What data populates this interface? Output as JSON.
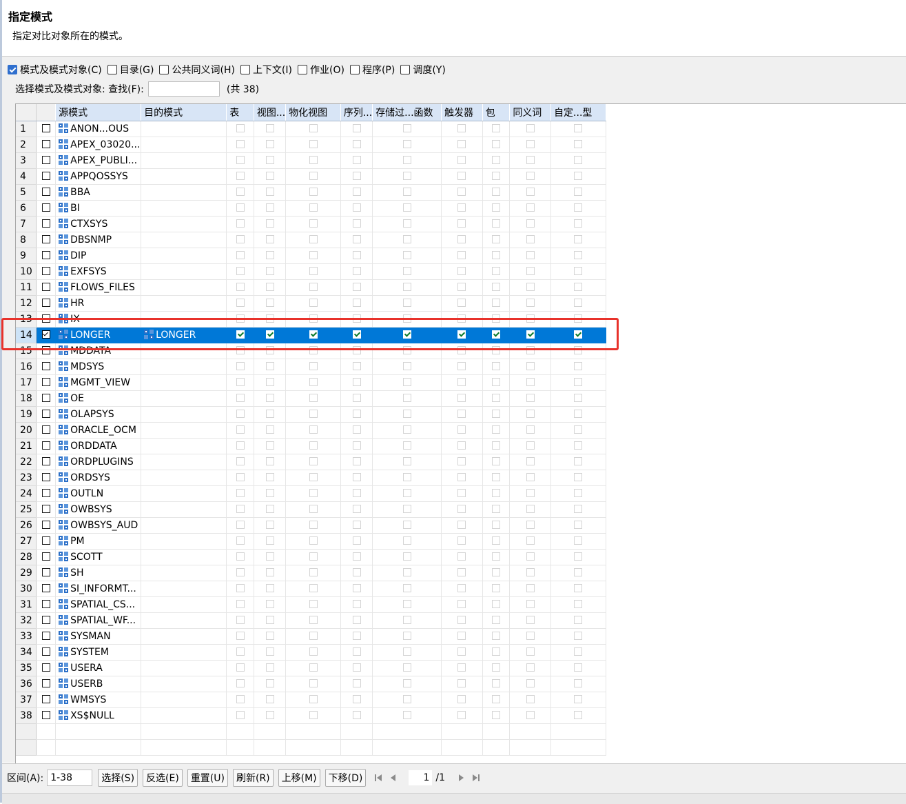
{
  "header": {
    "title": "指定模式",
    "description": "指定对比对象所在的模式。"
  },
  "options": [
    {
      "label": "模式及模式对象(C)",
      "checked": true
    },
    {
      "label": "目录(G)",
      "checked": false
    },
    {
      "label": "公共同义词(H)",
      "checked": false
    },
    {
      "label": "上下文(I)",
      "checked": false
    },
    {
      "label": "作业(O)",
      "checked": false
    },
    {
      "label": "程序(P)",
      "checked": false
    },
    {
      "label": "调度(Y)",
      "checked": false
    }
  ],
  "search": {
    "label": "选择模式及模式对象: 查找(F):",
    "value": "",
    "total": "(共 38)"
  },
  "columns": [
    "源模式",
    "目的模式",
    "表",
    "视图...",
    "物化视图",
    "序列...",
    "存储过...函数",
    "触发器",
    "包",
    "同义词",
    "自定...型"
  ],
  "rows": [
    {
      "no": "1",
      "source": "ANON...OUS",
      "target": "",
      "checked": false
    },
    {
      "no": "2",
      "source": "APEX_03020...",
      "target": "",
      "checked": false
    },
    {
      "no": "3",
      "source": "APEX_PUBLI...",
      "target": "",
      "checked": false
    },
    {
      "no": "4",
      "source": "APPQOSSYS",
      "target": "",
      "checked": false
    },
    {
      "no": "5",
      "source": "BBA",
      "target": "",
      "checked": false
    },
    {
      "no": "6",
      "source": "BI",
      "target": "",
      "checked": false
    },
    {
      "no": "7",
      "source": "CTXSYS",
      "target": "",
      "checked": false
    },
    {
      "no": "8",
      "source": "DBSNMP",
      "target": "",
      "checked": false
    },
    {
      "no": "9",
      "source": "DIP",
      "target": "",
      "checked": false
    },
    {
      "no": "10",
      "source": "EXFSYS",
      "target": "",
      "checked": false
    },
    {
      "no": "11",
      "source": "FLOWS_FILES",
      "target": "",
      "checked": false
    },
    {
      "no": "12",
      "source": "HR",
      "target": "",
      "checked": false
    },
    {
      "no": "13",
      "source": "IX",
      "target": "",
      "checked": false
    },
    {
      "no": "14",
      "source": "LONGER",
      "target": "LONGER",
      "checked": true
    },
    {
      "no": "15",
      "source": "MDDATA",
      "target": "",
      "checked": false
    },
    {
      "no": "16",
      "source": "MDSYS",
      "target": "",
      "checked": false
    },
    {
      "no": "17",
      "source": "MGMT_VIEW",
      "target": "",
      "checked": false
    },
    {
      "no": "18",
      "source": "OE",
      "target": "",
      "checked": false
    },
    {
      "no": "19",
      "source": "OLAPSYS",
      "target": "",
      "checked": false
    },
    {
      "no": "20",
      "source": "ORACLE_OCM",
      "target": "",
      "checked": false
    },
    {
      "no": "21",
      "source": "ORDDATA",
      "target": "",
      "checked": false
    },
    {
      "no": "22",
      "source": "ORDPLUGINS",
      "target": "",
      "checked": false
    },
    {
      "no": "23",
      "source": "ORDSYS",
      "target": "",
      "checked": false
    },
    {
      "no": "24",
      "source": "OUTLN",
      "target": "",
      "checked": false
    },
    {
      "no": "25",
      "source": "OWBSYS",
      "target": "",
      "checked": false
    },
    {
      "no": "26",
      "source": "OWBSYS_AUD",
      "target": "",
      "checked": false
    },
    {
      "no": "27",
      "source": "PM",
      "target": "",
      "checked": false
    },
    {
      "no": "28",
      "source": "SCOTT",
      "target": "",
      "checked": false
    },
    {
      "no": "29",
      "source": "SH",
      "target": "",
      "checked": false
    },
    {
      "no": "30",
      "source": "SI_INFORMT...",
      "target": "",
      "checked": false
    },
    {
      "no": "31",
      "source": "SPATIAL_CS...",
      "target": "",
      "checked": false
    },
    {
      "no": "32",
      "source": "SPATIAL_WF...",
      "target": "",
      "checked": false
    },
    {
      "no": "33",
      "source": "SYSMAN",
      "target": "",
      "checked": false
    },
    {
      "no": "34",
      "source": "SYSTEM",
      "target": "",
      "checked": false
    },
    {
      "no": "35",
      "source": "USERA",
      "target": "",
      "checked": false
    },
    {
      "no": "36",
      "source": "USERB",
      "target": "",
      "checked": false
    },
    {
      "no": "37",
      "source": "WMSYS",
      "target": "",
      "checked": false
    },
    {
      "no": "38",
      "source": "XS$NULL",
      "target": "",
      "checked": false
    }
  ],
  "selected_row": "14",
  "footer": {
    "range_label": "区间(A):",
    "range_value": "1-38",
    "buttons": [
      "选择(S)",
      "反选(E)",
      "重置(U)",
      "刷新(R)",
      "上移(M)",
      "下移(D)"
    ],
    "page_value": "1",
    "page_total": "/1"
  },
  "icons": [
    "schema-icon",
    "first-page-icon",
    "prev-page-icon",
    "next-page-icon",
    "last-page-icon"
  ],
  "colors": {
    "selection": "#0078d7",
    "header_bg": "#d8e5f6",
    "highlight_box": "#e8322b",
    "check_accent": "#2f6fce"
  }
}
